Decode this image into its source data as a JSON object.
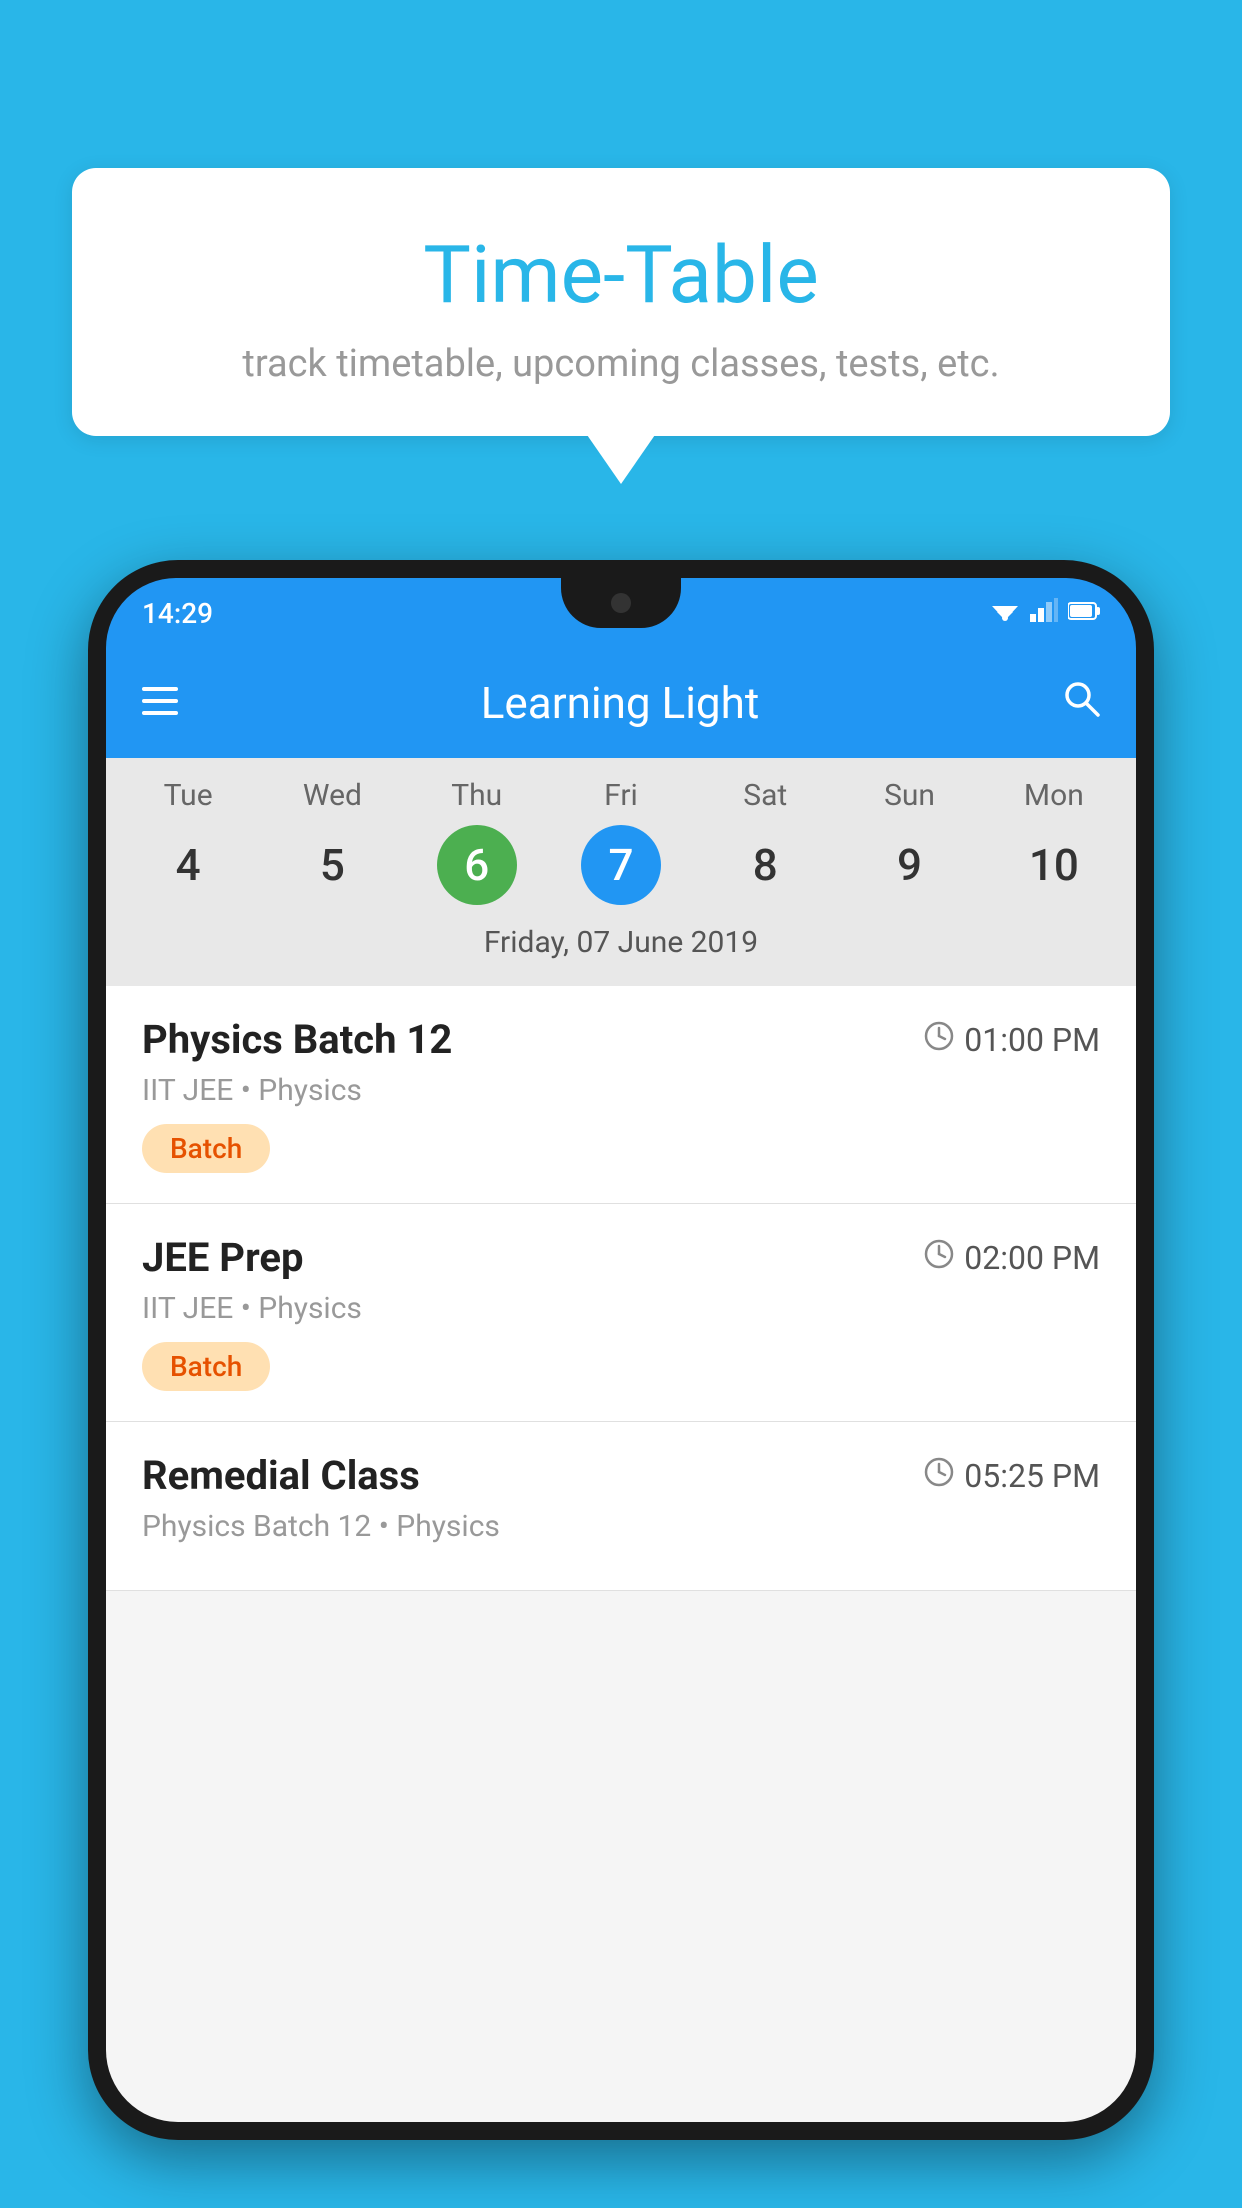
{
  "background_color": "#29b6e8",
  "speech_bubble": {
    "title": "Time-Table",
    "subtitle": "track timetable, upcoming classes, tests, etc."
  },
  "status_bar": {
    "time": "14:29",
    "icons": [
      "wifi",
      "signal",
      "battery"
    ]
  },
  "app_header": {
    "title": "Learning Light"
  },
  "calendar": {
    "days": [
      {
        "name": "Tue",
        "number": "4",
        "state": "normal"
      },
      {
        "name": "Wed",
        "number": "5",
        "state": "normal"
      },
      {
        "name": "Thu",
        "number": "6",
        "state": "today"
      },
      {
        "name": "Fri",
        "number": "7",
        "state": "selected"
      },
      {
        "name": "Sat",
        "number": "8",
        "state": "normal"
      },
      {
        "name": "Sun",
        "number": "9",
        "state": "normal"
      },
      {
        "name": "Mon",
        "number": "10",
        "state": "normal"
      }
    ],
    "selected_date_label": "Friday, 07 June 2019"
  },
  "schedule_items": [
    {
      "title": "Physics Batch 12",
      "time": "01:00 PM",
      "subtitle": "IIT JEE • Physics",
      "badge": "Batch"
    },
    {
      "title": "JEE Prep",
      "time": "02:00 PM",
      "subtitle": "IIT JEE • Physics",
      "badge": "Batch"
    },
    {
      "title": "Remedial Class",
      "time": "05:25 PM",
      "subtitle": "Physics Batch 12 • Physics",
      "badge": ""
    }
  ],
  "icons": {
    "hamburger": "≡",
    "search": "🔍",
    "clock": "🕐",
    "wifi": "▾",
    "signal": "▲",
    "battery": "▮"
  }
}
